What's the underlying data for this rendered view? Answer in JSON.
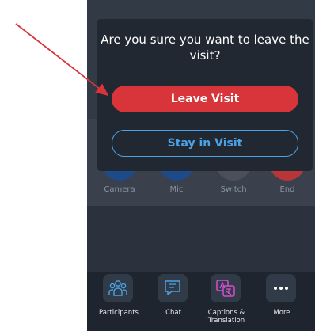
{
  "dialog": {
    "title": "Are you sure you want to leave the visit?",
    "leave_label": "Leave Visit",
    "stay_label": "Stay in Visit"
  },
  "controls": [
    {
      "label": "Camera",
      "color": "#1f4a8a"
    },
    {
      "label": "Mic",
      "color": "#1f4a8a"
    },
    {
      "label": "Switch",
      "color": "#4a4f5a"
    },
    {
      "label": "End",
      "color": "#b8363a"
    }
  ],
  "tabs": [
    {
      "label": "Participants",
      "icon": "participants-icon"
    },
    {
      "label": "Chat",
      "icon": "chat-icon"
    },
    {
      "label": "Captions & Translation",
      "icon": "captions-translation-icon"
    },
    {
      "label": "More",
      "icon": "more-icon"
    }
  ],
  "colors": {
    "leave": "#d8353a",
    "stay": "#4aa3e6",
    "annotation_arrow": "#d8353a"
  }
}
